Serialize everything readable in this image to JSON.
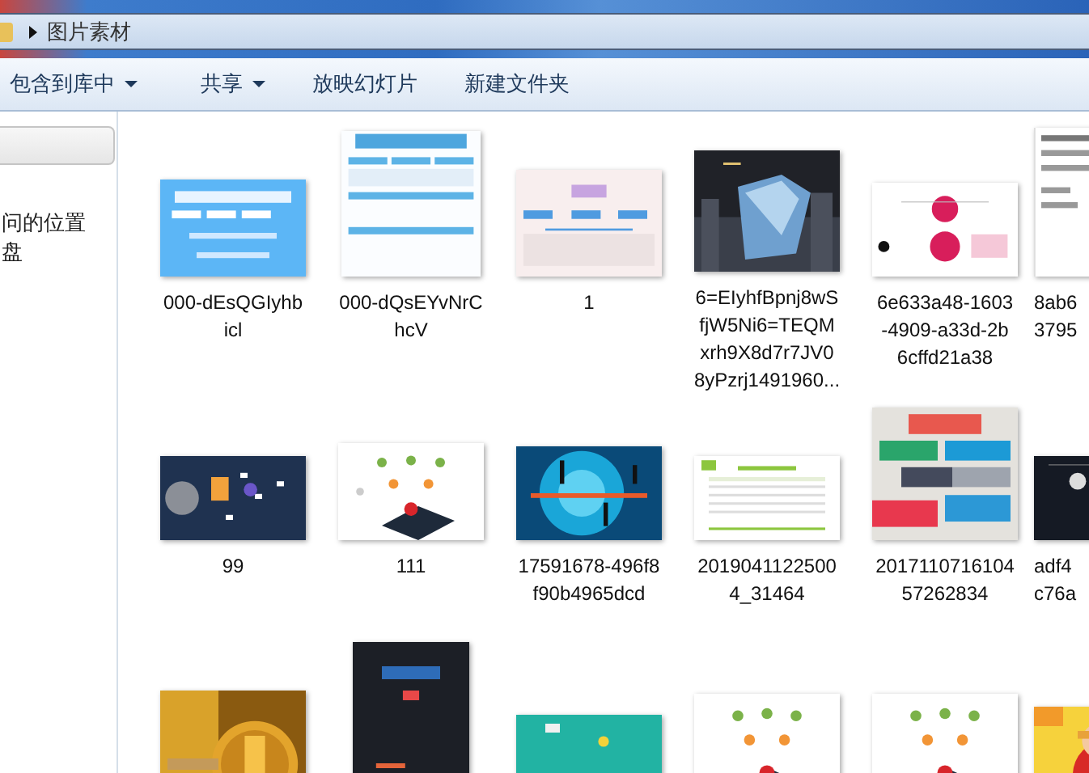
{
  "window": {
    "address": "图片素材"
  },
  "toolbar": [
    {
      "label": "包含到库中",
      "dropdown": true
    },
    {
      "label": "共享",
      "dropdown": true
    },
    {
      "label": "放映幻灯片",
      "dropdown": false
    },
    {
      "label": "新建文件夹",
      "dropdown": false
    }
  ],
  "nav": {
    "items": [
      {
        "label": "问的位置"
      },
      {
        "label": "盘"
      }
    ]
  },
  "files": [
    {
      "kind": "picture",
      "label_lines": [
        "000-dEsQGIyhb",
        "icl"
      ]
    },
    {
      "kind": "picture",
      "label_lines": [
        "000-dQsEYvNrC",
        "hcV"
      ]
    },
    {
      "kind": "picture",
      "label_lines": [
        "1"
      ]
    },
    {
      "kind": "picture",
      "label_lines": [
        "6=EIyhfBpnj8wS",
        "fjW5Ni6=TEQM",
        "xrh9X8d7r7JV0",
        "8yPzrj1491960..."
      ]
    },
    {
      "kind": "picture",
      "label_lines": [
        "6e633a48-1603",
        "-4909-a33d-2b",
        "6cffd21a38"
      ]
    },
    {
      "kind": "picture",
      "label_lines": [
        "8ab6",
        "3795"
      ]
    },
    {
      "kind": "picture",
      "label_lines": [
        "99"
      ]
    },
    {
      "kind": "picture",
      "label_lines": [
        "111"
      ]
    },
    {
      "kind": "picture",
      "label_lines": [
        "17591678-496f8",
        "f90b4965dcd"
      ]
    },
    {
      "kind": "picture",
      "label_lines": [
        "2019041122500",
        "4_31464"
      ]
    },
    {
      "kind": "picture",
      "label_lines": [
        "2017110716104",
        "57262834"
      ]
    },
    {
      "kind": "picture",
      "label_lines": [
        "adf4",
        "c76a"
      ]
    },
    {
      "kind": "picture"
    },
    {
      "kind": "picture"
    },
    {
      "kind": "picture"
    },
    {
      "kind": "picture"
    },
    {
      "kind": "picture"
    },
    {
      "kind": "picture"
    }
  ]
}
